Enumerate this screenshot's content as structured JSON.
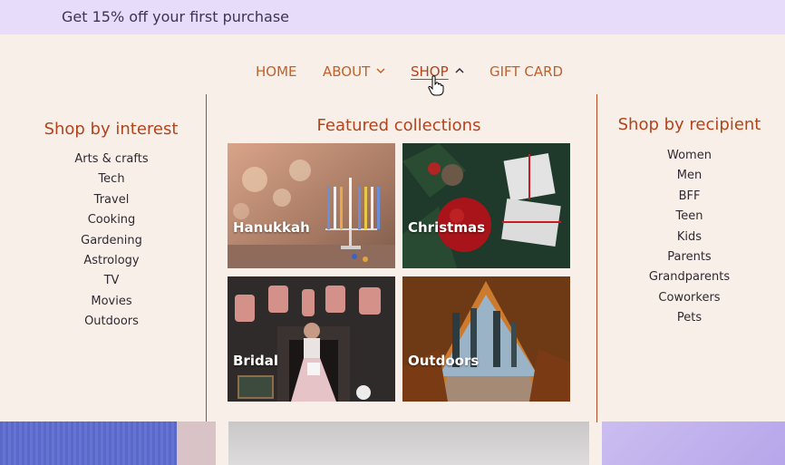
{
  "promo": {
    "text": "Get 15% off your first purchase"
  },
  "nav": {
    "home": "HOME",
    "about": "ABOUT",
    "shop": "SHOP",
    "gift_card": "GIFT CARD"
  },
  "interest": {
    "title": "Shop by interest",
    "items": [
      "Arts & crafts",
      "Tech",
      "Travel",
      "Cooking",
      "Gardening",
      "Astrology",
      "TV",
      "Movies",
      "Outdoors"
    ]
  },
  "featured": {
    "title": "Featured collections",
    "tiles": [
      {
        "label": "Hanukkah"
      },
      {
        "label": "Christmas"
      },
      {
        "label": "Bridal"
      },
      {
        "label": "Outdoors"
      }
    ]
  },
  "recipient": {
    "title": "Shop by recipient",
    "items": [
      "Women",
      "Men",
      "BFF",
      "Teen",
      "Kids",
      "Parents",
      "Grandparents",
      "Coworkers",
      "Pets"
    ]
  },
  "colors": {
    "accent": "#b3431c",
    "nav_text": "#c0612c",
    "promo_bg": "#e8dcfb",
    "page_bg": "#f8f0e8"
  }
}
